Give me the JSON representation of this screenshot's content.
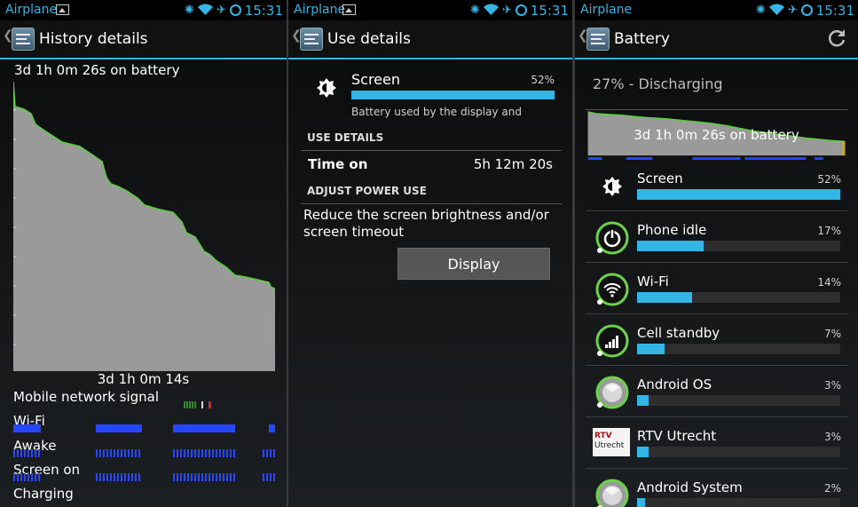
{
  "statusbar": {
    "carrier": "Airplane",
    "time": "15:31"
  },
  "panel_history": {
    "title": "History details",
    "battery_time": "3d 1h 0m 26s on battery",
    "chart_duration": "3d 1h 0m 14s",
    "rows": [
      "Mobile network signal",
      "Wi-Fi",
      "Awake",
      "Screen on",
      "Charging"
    ]
  },
  "panel_use": {
    "title": "Use details",
    "item": {
      "name": "Screen",
      "percent": "52%",
      "level": 52,
      "desc": "Battery used by the display and"
    },
    "use_details_header": "USE DETAILS",
    "time_on_label": "Time on",
    "time_on_value": "5h 12m 20s",
    "adjust_header": "ADJUST POWER USE",
    "adjust_text": "Reduce the screen brightness and/or screen timeout",
    "button_label": "Display"
  },
  "panel_battery": {
    "title": "Battery",
    "status": "27% - Discharging",
    "chart_label": "3d 1h 0m 26s on battery",
    "items": [
      {
        "name": "Screen",
        "percent": "52%",
        "level": 52,
        "icon": "brightness-icon"
      },
      {
        "name": "Phone idle",
        "percent": "17%",
        "level": 17,
        "icon": "power-icon"
      },
      {
        "name": "Wi-Fi",
        "percent": "14%",
        "level": 14,
        "icon": "wifi-icon"
      },
      {
        "name": "Cell standby",
        "percent": "7%",
        "level": 7,
        "icon": "signal-icon"
      },
      {
        "name": "Android OS",
        "percent": "3%",
        "level": 3,
        "icon": "android-os-icon"
      },
      {
        "name": "RTV Utrecht",
        "percent": "3%",
        "level": 3,
        "icon": "rtv-utrecht-logo"
      },
      {
        "name": "Android System",
        "percent": "2%",
        "level": 2,
        "icon": "android-system-icon"
      }
    ]
  },
  "rtv_logo": {
    "line1": "RTV",
    "line2": "Utrecht"
  },
  "colors": {
    "accent": "#33b5e5",
    "chart_fill": "#9a9a9a",
    "chart_line": "#55d23a",
    "timeline": "#2646ff"
  }
}
